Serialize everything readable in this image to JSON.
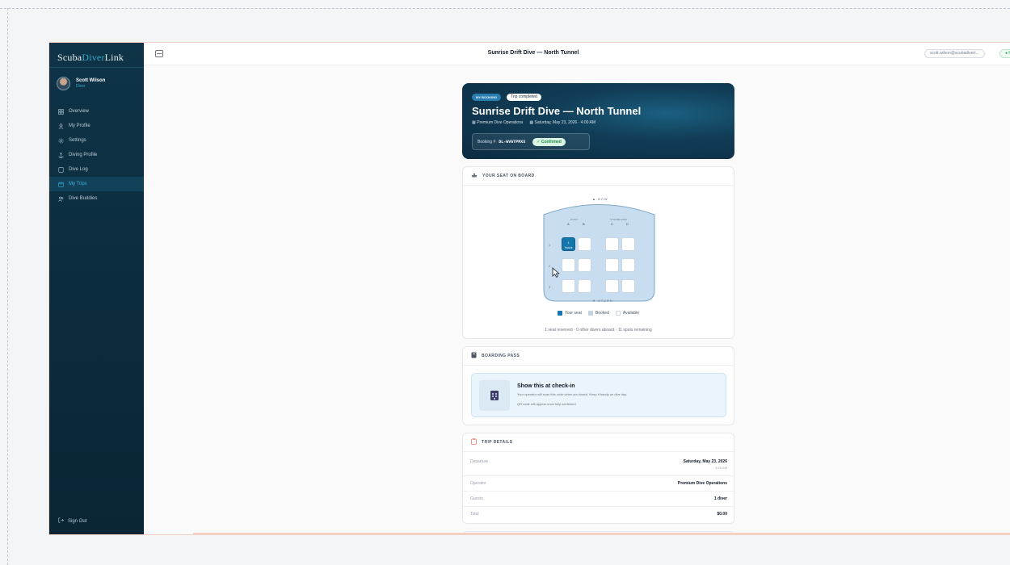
{
  "brand": {
    "part1": "Scuba",
    "part2": "Diver",
    "part3": "Link"
  },
  "user": {
    "name": "Scott Wilson",
    "role": "Diver"
  },
  "nav": {
    "items": [
      {
        "label": "Overview",
        "icon": "grid-icon"
      },
      {
        "label": "My Profile",
        "icon": "user-icon"
      },
      {
        "label": "Settings",
        "icon": "gear-icon"
      },
      {
        "label": "Diving Profile",
        "icon": "anchor-icon"
      },
      {
        "label": "Dive Log",
        "icon": "book-icon"
      },
      {
        "label": "My Trips",
        "icon": "calendar-icon",
        "active": true
      },
      {
        "label": "Dive Buddies",
        "icon": "users-icon"
      }
    ],
    "signout": "Sign Out"
  },
  "topbar": {
    "title": "Sunrise Drift Dive — North Tunnel",
    "email": "scott.wilson@scubadivert...",
    "location": "● Playa del Carmen · Ze"
  },
  "hero": {
    "tag": "MY BOOKING",
    "status": "Trip completed",
    "title": "Sunrise Drift Dive — North Tunnel",
    "operator": "Premium Dive Operations",
    "datetime": "Saturday, May 23, 2026 · 4:00 AM",
    "booking_label": "Booking #",
    "booking_number": "DL-WVGTPMXX",
    "confirmed": "✓ Confirmed"
  },
  "seat_card": {
    "heading": "YOUR SEAT ON BOARD",
    "bow": "▲ BOW",
    "stern": "▼ STERN",
    "port": "PORT",
    "starboard": "STARBOARD",
    "col_a": "A",
    "col_b": "B",
    "col_c": "C",
    "col_d": "D",
    "row_1": "1",
    "row_2": "2",
    "row_3": "3",
    "my_seat_number": "1",
    "my_seat_label": "Yours",
    "legend_yours": "Your seat",
    "legend_booked": "Booked",
    "legend_available": "Available",
    "summary": "1 seat reserved · 0 other divers aboard · 11 spots remaining",
    "colors": {
      "yours": "#1476ad",
      "booked": "#c5d3df",
      "available": "#ffffff"
    }
  },
  "pass_card": {
    "heading": "BOARDING PASS",
    "title": "Show this at check-in",
    "subtitle": "Your operator will scan this code when you board. Keep it handy on dive day.",
    "note": "QR code will appear once fully confirmed"
  },
  "details_card": {
    "heading": "TRIP DETAILS",
    "departure_label": "Departure",
    "departure_value": "Saturday, May 23, 2026",
    "departure_time": "4:00 AM",
    "operator_label": "Operator",
    "operator_value": "Premium Dive Operations",
    "guests_label": "Guests",
    "guests_value": "1 diver",
    "total_label": "Total",
    "total_value": "$0.00"
  }
}
